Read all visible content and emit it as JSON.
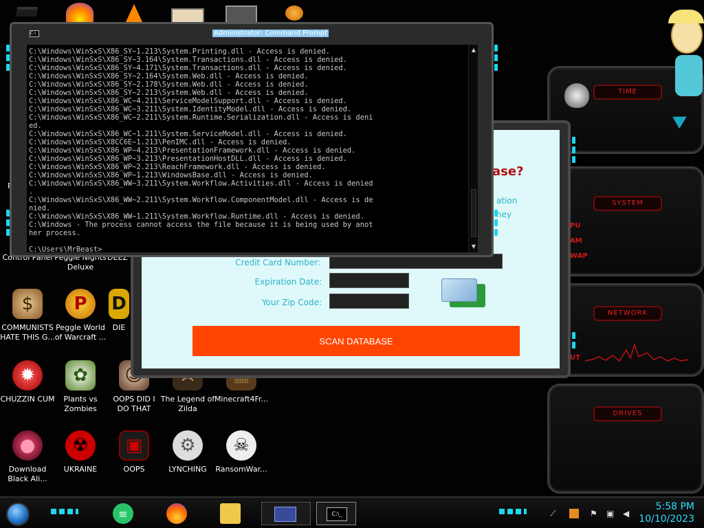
{
  "desktop": {
    "icons": [
      {
        "name": "Control Panel",
        "glyph": "⚙"
      },
      {
        "name": "Peggle Nights Deluxe",
        "glyph": "☾"
      },
      {
        "name": "DEEZ",
        "glyph": "◆"
      },
      {
        "name": "COMMUNISTS HATE THIS G...",
        "glyph": "$"
      },
      {
        "name": "Peggle World of Warcraft ...",
        "glyph": "P"
      },
      {
        "name": "DIE",
        "glyph": "D"
      },
      {
        "name": "CHUZZIN CUM",
        "glyph": "✹"
      },
      {
        "name": "Plants vs Zombies",
        "glyph": "✿"
      },
      {
        "name": "OOPS DID I DO THAT",
        "glyph": "☺"
      },
      {
        "name": "The Legend of Zilda",
        "glyph": "⚔"
      },
      {
        "name": "Minecraft4Fr...",
        "glyph": "▦"
      },
      {
        "name": "Download Black Ali...",
        "glyph": "●"
      },
      {
        "name": "UKRAINE",
        "glyph": "☢"
      },
      {
        "name": "OOPS",
        "glyph": "▣"
      },
      {
        "name": "LYNCHING",
        "glyph": "⚙"
      },
      {
        "name": "RansomWar...",
        "glyph": "☠"
      }
    ],
    "left_partial": {
      "rec": "Re",
      "n": "N"
    }
  },
  "widgets": {
    "time": "TIME",
    "system": "SYSTEM",
    "system_lines": [
      "PU",
      "AM",
      "WAP"
    ],
    "network": "NETWORK",
    "network_line": "UT",
    "drives": "DRIVES"
  },
  "scanner": {
    "heading_partial": "ase?",
    "text_line1": "ation",
    "text_line2": "ney",
    "credit_card_label": "Credit Card Number:",
    "expiration_label": "Expiration Date:",
    "zip_label": "Your Zip Code:",
    "scan_button": "SCAN DATABASE"
  },
  "cmd": {
    "title": "Administrator: Command Prompt",
    "lines": [
      "C:\\Windows\\WinSxS\\X86_SY~1.213\\System.Printing.dll - Access is denied.",
      "C:\\Windows\\WinSxS\\X86_SY~3.164\\System.Transactions.dll - Access is denied.",
      "C:\\Windows\\WinSxS\\X86_SY~4.171\\System.Transactions.dll - Access is denied.",
      "C:\\Windows\\WinSxS\\X86_SY~2.164\\System.Web.dll - Access is denied.",
      "C:\\Windows\\WinSxS\\X86_SY~2.178\\System.Web.dll - Access is denied.",
      "C:\\Windows\\WinSxS\\X86_SY~2.213\\System.Web.dll - Access is denied.",
      "C:\\Windows\\WinSxS\\X86_WC~4.211\\ServiceModelSupport.dll - Access is denied.",
      "C:\\Windows\\WinSxS\\X86_WC~3.211\\System.IdentityModel.dll - Access is denied.",
      "C:\\Windows\\WinSxS\\X86_WC~2.211\\System.Runtime.Serialization.dll - Access is deni",
      "ed.",
      "C:\\Windows\\WinSxS\\X86_WC~1.211\\System.ServiceModel.dll - Access is denied.",
      "C:\\Windows\\WinSxS\\X8CC6E~1.213\\PenIMC.dll - Access is denied.",
      "C:\\Windows\\WinSxS\\X86_WP~4.213\\PresentationFramework.dll - Access is denied.",
      "C:\\Windows\\WinSxS\\X86_WP~3.213\\PresentationHostDLL.dll - Access is denied.",
      "C:\\Windows\\WinSxS\\X86_WP~2.213\\ReachFramework.dll - Access is denied.",
      "C:\\Windows\\WinSxS\\X86_WP~1.213\\WindowsBase.dll - Access is denied.",
      "C:\\Windows\\WinSxS\\X86_WW~3.211\\System.Workflow.Activities.dll - Access is denied",
      ".",
      "C:\\Windows\\WinSxS\\X86_WW~2.211\\System.Workflow.ComponentModel.dll - Access is de",
      "nied.",
      "C:\\Windows\\WinSxS\\X86_WW~1.211\\System.Workflow.Runtime.dll - Access is denied.",
      "C:\\Windows - The process cannot access the file because it is being used by anot",
      "her process.",
      "",
      "C:\\Users\\MrBeast>_"
    ]
  },
  "taskbar": {
    "time": "5:58 PM",
    "date": "10/10/2023"
  }
}
